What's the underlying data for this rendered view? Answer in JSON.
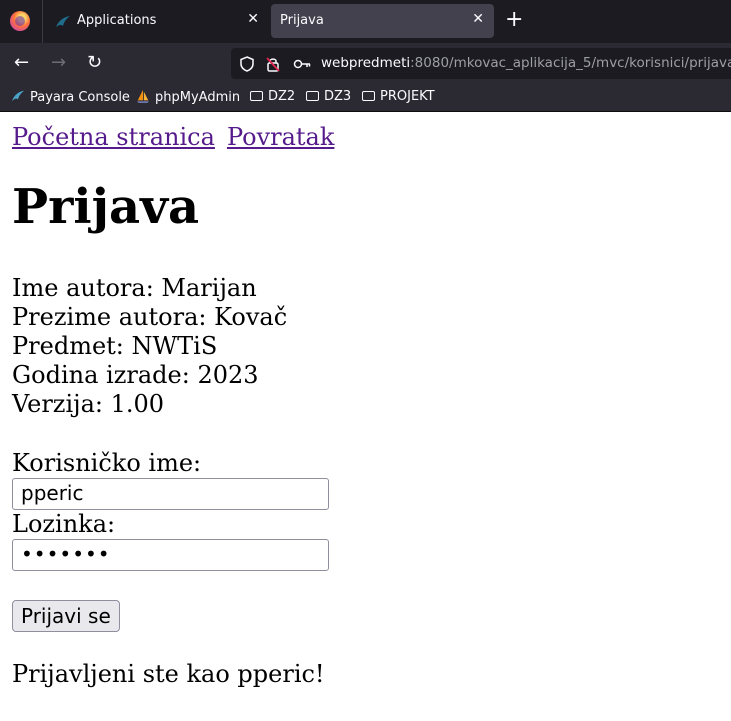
{
  "browser": {
    "tabs": [
      {
        "label": "Applications",
        "icon": "payara-fish-icon"
      },
      {
        "label": "Prijava",
        "icon": "none"
      }
    ],
    "new_tab_label": "+",
    "url_host": "webpredmeti",
    "url_rest": ":8080/mkovac_aplikacija_5/mvc/korisnici/prijava",
    "bookmarks": [
      {
        "label": "Payara Console",
        "icon": "payara-fish-icon"
      },
      {
        "label": "phpMyAdmin",
        "icon": "sailboat-icon"
      },
      {
        "label": "DZ2",
        "icon": "folder-icon"
      },
      {
        "label": "DZ3",
        "icon": "folder-icon"
      },
      {
        "label": "PROJEKT",
        "icon": "folder-icon"
      }
    ]
  },
  "page": {
    "links": [
      {
        "label": "Početna stranica"
      },
      {
        "label": "Povratak"
      }
    ],
    "title": "Prijava",
    "info": [
      "Ime autora: Marijan",
      "Prezime autora: Kovač",
      "Predmet: NWTiS",
      "Godina izrade: 2023",
      "Verzija: 1.00"
    ],
    "form": {
      "username_label": "Korisničko ime:",
      "username_value": "pperic",
      "password_label": "Lozinka:",
      "password_masked": "•••••••",
      "submit_label": "Prijavi se"
    },
    "status": "Prijavljeni ste kao pperic!"
  },
  "colors": {
    "link": "#551a8b",
    "tabbar": "#1c1b22",
    "toolbar": "#2b2a33"
  }
}
